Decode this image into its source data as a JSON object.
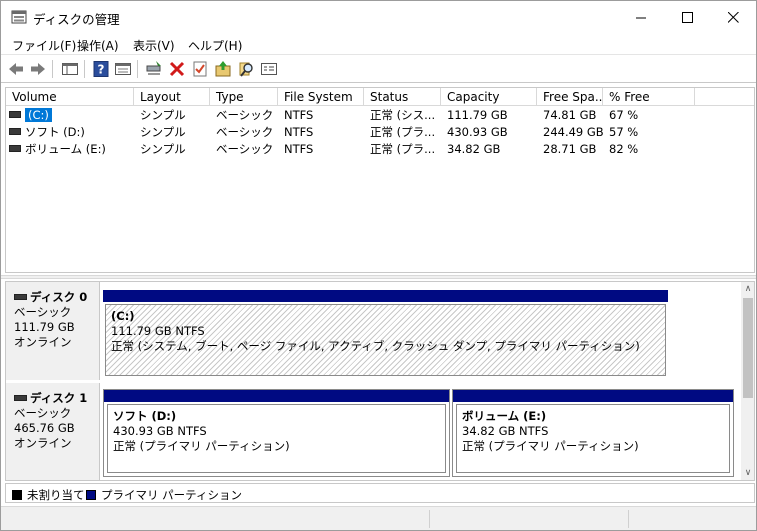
{
  "window": {
    "title": "ディスクの管理"
  },
  "menu": [
    "ファイル(F)",
    "操作(A)",
    "表示(V)",
    "ヘルプ(H)"
  ],
  "toolbar_icons": [
    "back-icon",
    "forward-icon",
    "show-hide-tree-icon",
    "help-icon",
    "properties-icon",
    "connect-icon",
    "delete-icon",
    "check-icon",
    "import-icon",
    "search-icon",
    "console-icon"
  ],
  "columns": [
    "Volume",
    "Layout",
    "Type",
    "File System",
    "Status",
    "Capacity",
    "Free Spa...",
    "% Free"
  ],
  "volumes": [
    {
      "name": "(C:)",
      "layout": "シンプル",
      "type": "ベーシック",
      "fs": "NTFS",
      "status": "正常 (シス...",
      "capacity": "111.79 GB",
      "free": "74.81 GB",
      "pct": "67 %"
    },
    {
      "name": "ソフト (D:)",
      "layout": "シンプル",
      "type": "ベーシック",
      "fs": "NTFS",
      "status": "正常 (プラ...",
      "capacity": "430.93 GB",
      "free": "244.49 GB",
      "pct": "57 %"
    },
    {
      "name": "ボリューム (E:)",
      "layout": "シンプル",
      "type": "ベーシック",
      "fs": "NTFS",
      "status": "正常 (プラ...",
      "capacity": "34.82 GB",
      "free": "28.71 GB",
      "pct": "82 %"
    }
  ],
  "disks": [
    {
      "name": "ディスク 0",
      "type": "ベーシック",
      "size": "111.79 GB",
      "state": "オンライン",
      "partitions": [
        {
          "name": "(C:)",
          "size": "111.79 GB NTFS",
          "status": "正常 (システム, ブート, ページ ファイル, アクティブ, クラッシュ ダンプ, プライマリ パーティション)"
        }
      ]
    },
    {
      "name": "ディスク 1",
      "type": "ベーシック",
      "size": "465.76 GB",
      "state": "オンライン",
      "partitions": [
        {
          "name": "ソフト  (D:)",
          "size": "430.93 GB NTFS",
          "status": "正常 (プライマリ パーティション)"
        },
        {
          "name": "ボリューム  (E:)",
          "size": "34.82 GB NTFS",
          "status": "正常 (プライマリ パーティション)"
        }
      ]
    }
  ],
  "legend": [
    {
      "label": "未割り当て",
      "color": "#000000"
    },
    {
      "label": "プライマリ パーティション",
      "color": "#000a82"
    }
  ],
  "colors": {
    "primary_partition": "#000a82",
    "selection": "#0078d7"
  }
}
